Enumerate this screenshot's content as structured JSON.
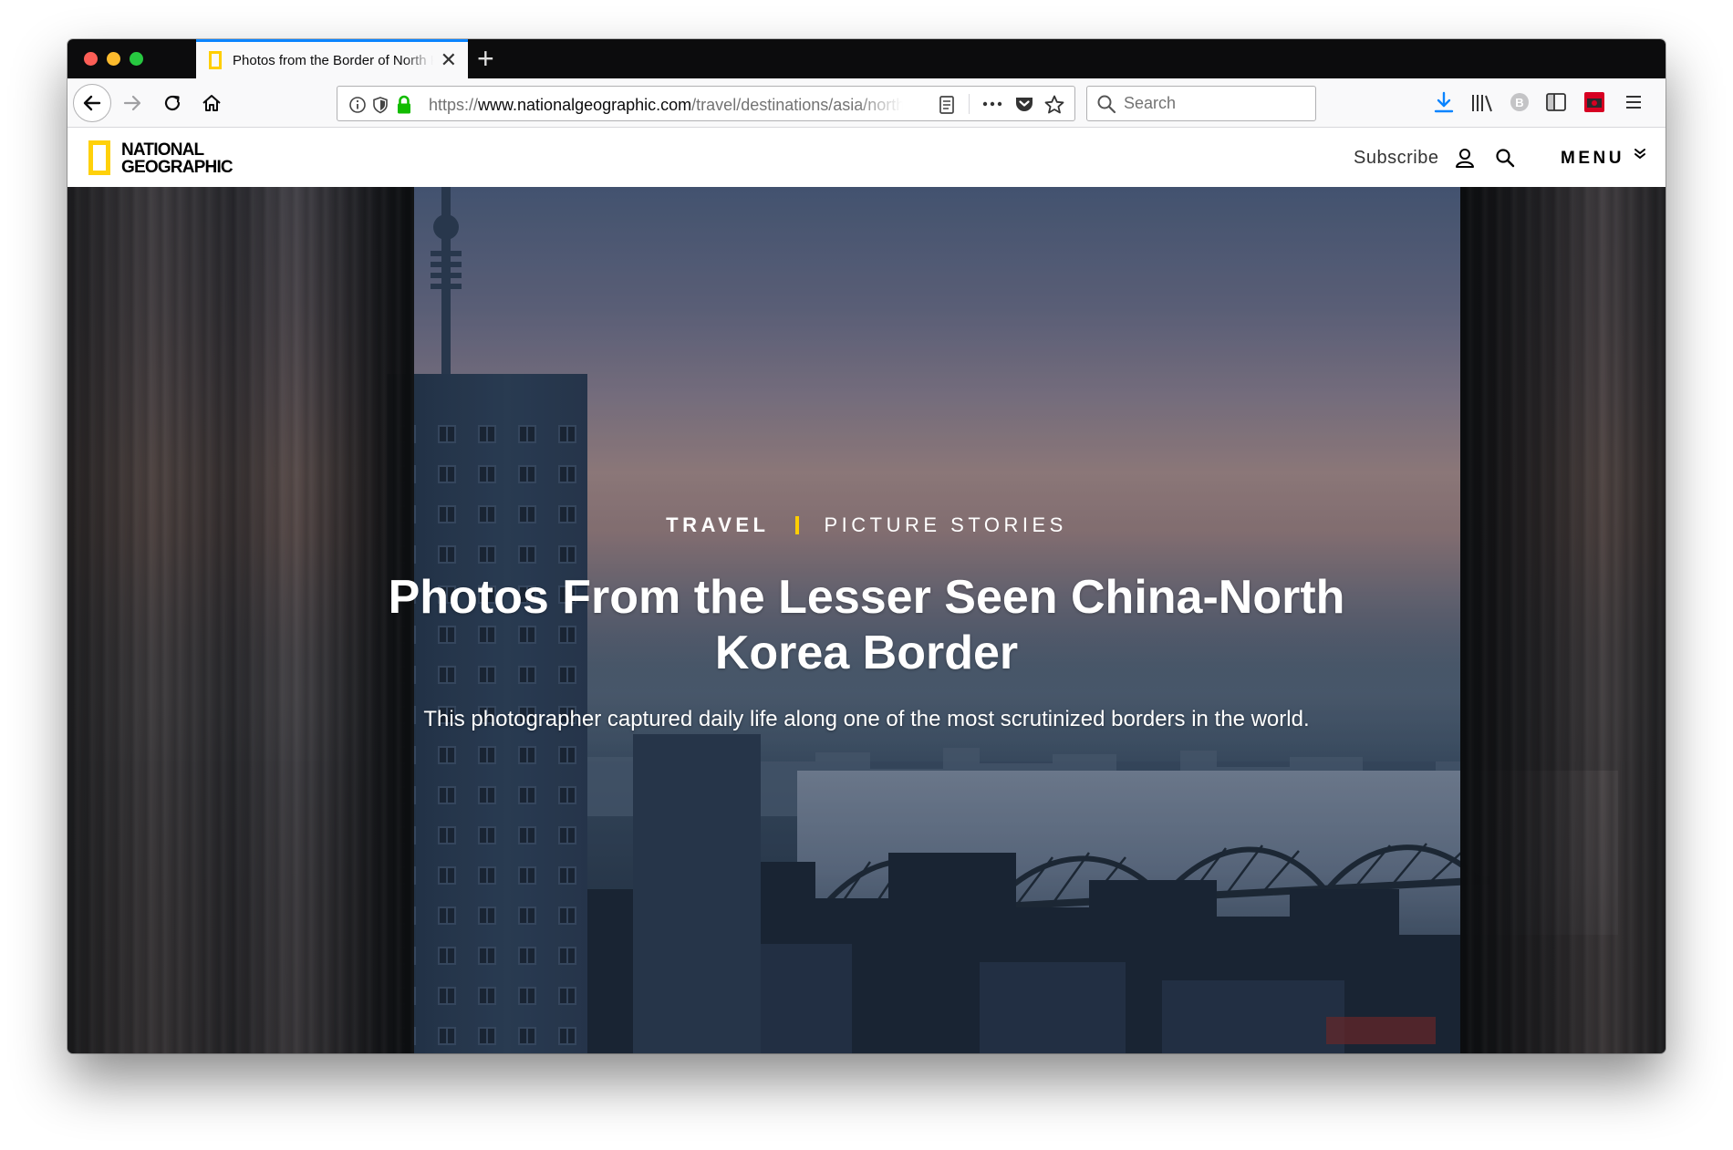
{
  "browser": {
    "tab": {
      "title": "Photos from the Border of North Korea",
      "close_glyph": "✕"
    },
    "new_tab_glyph": "+",
    "url": "https://www.nationalgeographic.com/travel/destinations/asia/north-korea/",
    "search": {
      "placeholder": "Search"
    },
    "colors": {
      "tab_accent": "#0a84ff",
      "favicon": "#ffce00",
      "download_icon": "#0a84ff"
    }
  },
  "site": {
    "logo": {
      "line1": "NATIONAL",
      "line2": "GEOGRAPHIC",
      "frame_color": "#ffd10a"
    },
    "nav": {
      "subscribe": "Subscribe",
      "menu": "MENU"
    }
  },
  "hero": {
    "kicker_section": "TRAVEL",
    "kicker_sub": "PICTURE STORIES",
    "headline": "Photos From the Lesser Seen China-North Korea Border",
    "dek": "This photographer captured daily life along one of the most scrutinized borders in the world.",
    "kicker_bar_color": "#ffce00"
  }
}
